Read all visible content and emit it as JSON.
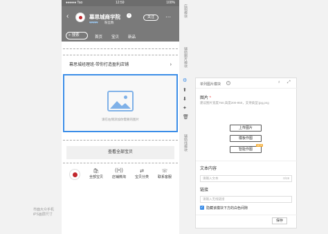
{
  "status_bar": {
    "carrier": "●●●●● Tao",
    "time": "12:59",
    "battery": "100%"
  },
  "shop": {
    "name": "幕思城商学院",
    "hearts": "♥♥♥♥♥",
    "fans": "粉丝数",
    "follow_label": "关注",
    "search_label": "搜索",
    "nav": [
      "首页",
      "宝贝",
      "新品"
    ]
  },
  "banner": {
    "text": "幕思城经理班-带你打造盈利店铺"
  },
  "image_block": {
    "hint": "请在右侧添加你需要的图片"
  },
  "view_all": "查看全部宝贝",
  "bottom_bar": {
    "items": [
      {
        "icon": "bag-icon",
        "label": "全部宝贝"
      },
      {
        "icon": "broadcast-icon",
        "label": "店铺微淘"
      },
      {
        "icon": "share-icon",
        "label": "宝贝分类"
      },
      {
        "icon": "contact-icon",
        "label": "联系客服"
      }
    ]
  },
  "side_caption": "市面大众手机\niPS画屏尺寸",
  "vertical_tabs": {
    "store_module": "店招模块",
    "aux_module": "辅助图片模块",
    "aux_line": "辅助线模块"
  },
  "panel": {
    "title": "单列图片模块",
    "image_label": "图片",
    "image_hint": "建议图片宽度750,高度200-950，支持类型:jpg,png",
    "upload_label": "上传图片",
    "template_label": "模板作图",
    "smart_label": "智能作图",
    "new_badge": "NEW",
    "text_label": "文本内容",
    "text_placeholder": "请输入文本",
    "text_counter": "0/19",
    "link_label": "链接",
    "link_placeholder": "请输入无线链接",
    "checkbox_label": "隐藏该模块下方的白色间隙",
    "save_label": "保存"
  },
  "colors": {
    "accent": "#3b8de8",
    "header_bg": "#7a7a7a",
    "brand_red": "#c1272d"
  }
}
